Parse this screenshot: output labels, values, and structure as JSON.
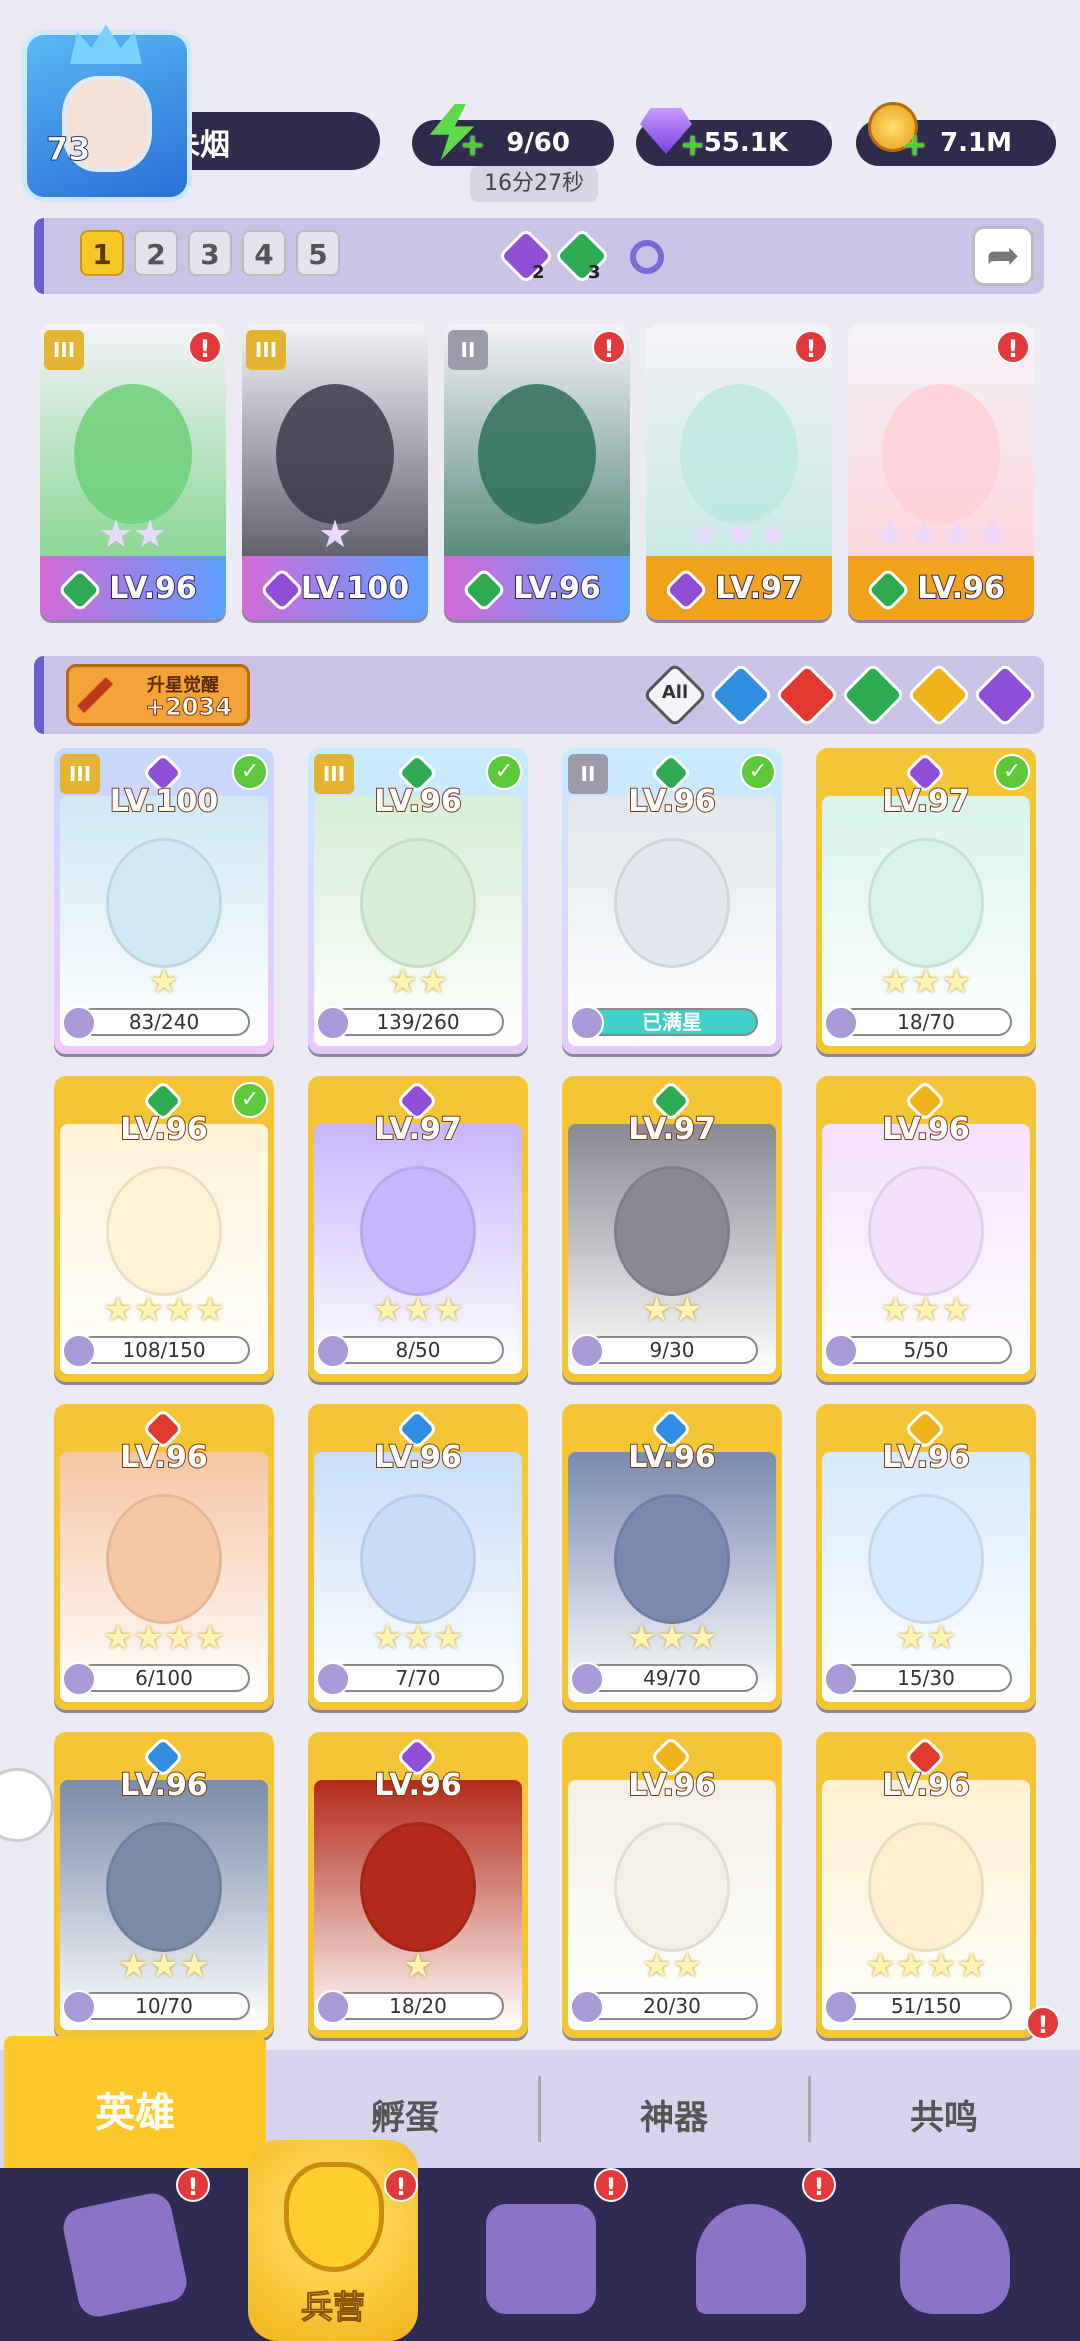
{
  "player": {
    "level": "73",
    "name": "朱烟"
  },
  "resources": {
    "energy": "9/60",
    "energy_timer": "16分27秒",
    "gems": "55.1K",
    "coins": "7.1M"
  },
  "team_tabs": [
    "1",
    "2",
    "3",
    "4",
    "5"
  ],
  "team_counts": {
    "purple": "2",
    "green": "3"
  },
  "team_slots": [
    {
      "level": "LV.96",
      "rank": "III",
      "badge": "!",
      "elem": "green",
      "stars": "★★"
    },
    {
      "level": "LV.100",
      "rank": "III",
      "badge": "",
      "elem": "purple",
      "stars": "★"
    },
    {
      "level": "LV.96",
      "rank": "II",
      "badge": "!",
      "elem": "green",
      "stars": ""
    },
    {
      "level": "LV.97",
      "rank": "",
      "badge": "!",
      "elem": "purple",
      "stars": "★★★"
    },
    {
      "level": "LV.96",
      "rank": "",
      "badge": "!",
      "elem": "green",
      "stars": "★★★★"
    }
  ],
  "awaken": {
    "label": "升星觉醒",
    "value": "+2034"
  },
  "filters": {
    "all_label": "All"
  },
  "heroes": [
    {
      "level": "LV.100",
      "progress": "83/240",
      "elem": "purple",
      "check": true,
      "rank": "III",
      "stars": "★"
    },
    {
      "level": "LV.96",
      "progress": "139/260",
      "elem": "green",
      "check": true,
      "rank": "III",
      "stars": "★★"
    },
    {
      "level": "LV.96",
      "progress": "已满星",
      "elem": "green",
      "check": true,
      "rank": "II",
      "stars": ""
    },
    {
      "level": "LV.97",
      "progress": "18/70",
      "elem": "purple",
      "check": true,
      "rank": "",
      "stars": "★★★"
    },
    {
      "level": "LV.96",
      "progress": "108/150",
      "elem": "green",
      "check": true,
      "rank": "",
      "stars": "★★★★"
    },
    {
      "level": "LV.97",
      "progress": "8/50",
      "elem": "purple",
      "check": false,
      "rank": "",
      "stars": "★★★"
    },
    {
      "level": "LV.97",
      "progress": "9/30",
      "elem": "green",
      "check": false,
      "rank": "",
      "stars": "★★"
    },
    {
      "level": "LV.96",
      "progress": "5/50",
      "elem": "gold",
      "check": false,
      "rank": "",
      "stars": "★★★"
    },
    {
      "level": "LV.96",
      "progress": "6/100",
      "elem": "red",
      "check": false,
      "rank": "",
      "stars": "★★★★"
    },
    {
      "level": "LV.96",
      "progress": "7/70",
      "elem": "blue",
      "check": false,
      "rank": "",
      "stars": "★★★"
    },
    {
      "level": "LV.96",
      "progress": "49/70",
      "elem": "blue",
      "check": false,
      "rank": "",
      "stars": "★★★"
    },
    {
      "level": "LV.96",
      "progress": "15/30",
      "elem": "gold",
      "check": false,
      "rank": "",
      "stars": "★★"
    },
    {
      "level": "LV.96",
      "progress": "10/70",
      "elem": "blue",
      "check": false,
      "rank": "",
      "stars": "★★★"
    },
    {
      "level": "LV.96",
      "progress": "18/20",
      "elem": "purple",
      "check": false,
      "rank": "",
      "stars": "★"
    },
    {
      "level": "LV.96",
      "progress": "20/30",
      "elem": "gold",
      "check": false,
      "rank": "",
      "stars": "★★"
    },
    {
      "level": "LV.96",
      "progress": "51/150",
      "elem": "red",
      "check": false,
      "rank": "",
      "stars": "★★★★"
    }
  ],
  "sub_tabs": [
    "英雄",
    "孵蛋",
    "神器",
    "共鸣"
  ],
  "nav": {
    "barracks": "兵营"
  },
  "colors": {
    "purple": "#8e4fd6",
    "green": "#2eaa52",
    "red": "#e23a2e",
    "blue": "#2f8ee0",
    "gold": "#f0b21a",
    "accent": "#f6c825"
  }
}
